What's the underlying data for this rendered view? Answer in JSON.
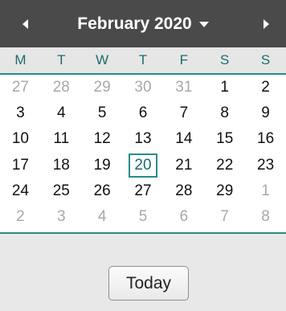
{
  "header": {
    "title": "February 2020",
    "prev_icon": "triangle-left",
    "next_icon": "triangle-right",
    "dropdown_icon": "triangle-down"
  },
  "weekdays": [
    "M",
    "T",
    "W",
    "T",
    "F",
    "S",
    "S"
  ],
  "weeks": [
    [
      {
        "label": "27",
        "muted": true
      },
      {
        "label": "28",
        "muted": true
      },
      {
        "label": "29",
        "muted": true
      },
      {
        "label": "30",
        "muted": true
      },
      {
        "label": "31",
        "muted": true
      },
      {
        "label": "1",
        "muted": false
      },
      {
        "label": "2",
        "muted": false
      }
    ],
    [
      {
        "label": "3",
        "muted": false
      },
      {
        "label": "4",
        "muted": false
      },
      {
        "label": "5",
        "muted": false
      },
      {
        "label": "6",
        "muted": false
      },
      {
        "label": "7",
        "muted": false
      },
      {
        "label": "8",
        "muted": false
      },
      {
        "label": "9",
        "muted": false
      }
    ],
    [
      {
        "label": "10",
        "muted": false
      },
      {
        "label": "11",
        "muted": false
      },
      {
        "label": "12",
        "muted": false
      },
      {
        "label": "13",
        "muted": false
      },
      {
        "label": "14",
        "muted": false
      },
      {
        "label": "15",
        "muted": false
      },
      {
        "label": "16",
        "muted": false
      }
    ],
    [
      {
        "label": "17",
        "muted": false
      },
      {
        "label": "18",
        "muted": false
      },
      {
        "label": "19",
        "muted": false
      },
      {
        "label": "20",
        "muted": false,
        "today": true
      },
      {
        "label": "21",
        "muted": false
      },
      {
        "label": "22",
        "muted": false
      },
      {
        "label": "23",
        "muted": false
      }
    ],
    [
      {
        "label": "24",
        "muted": false
      },
      {
        "label": "25",
        "muted": false
      },
      {
        "label": "26",
        "muted": false
      },
      {
        "label": "27",
        "muted": false
      },
      {
        "label": "28",
        "muted": false
      },
      {
        "label": "29",
        "muted": false
      },
      {
        "label": "1",
        "muted": true
      }
    ],
    [
      {
        "label": "2",
        "muted": true
      },
      {
        "label": "3",
        "muted": true
      },
      {
        "label": "4",
        "muted": true
      },
      {
        "label": "5",
        "muted": true
      },
      {
        "label": "6",
        "muted": true
      },
      {
        "label": "7",
        "muted": true
      },
      {
        "label": "8",
        "muted": true
      }
    ]
  ],
  "footer": {
    "today_label": "Today"
  },
  "colors": {
    "header_bg": "#4a4a4a",
    "accent": "#2a8a8a",
    "weekday_bg": "#e6e6e6",
    "muted_text": "#a8a8a8"
  }
}
